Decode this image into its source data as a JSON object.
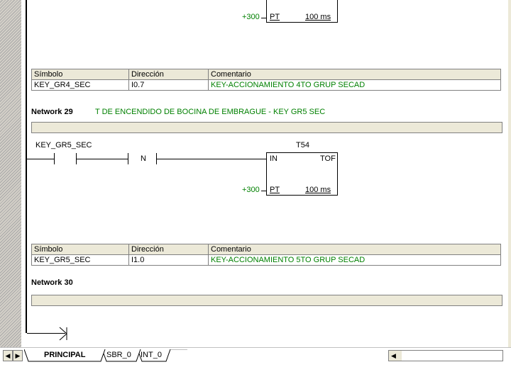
{
  "top_timer": {
    "pt_value": "+300",
    "pt_label": "PT",
    "time_base": "100 ms"
  },
  "symbol_table_1": {
    "headers": [
      "Símbolo",
      "Dirección",
      "Comentario"
    ],
    "row": [
      "KEY_GR4_SEC",
      "I0.7",
      "KEY-ACCIONAMIENTO 4TO GRUP SECAD"
    ]
  },
  "network_29": {
    "label": "Network 29",
    "title": "T DE ENCENDIDO DE BOCINA DE EMBRAGUE - KEY GR5 SEC",
    "contact_symbol": "KEY_GR5_SEC",
    "edge_label": "N",
    "timer_name": "T54",
    "timer_in": "IN",
    "timer_type": "TOF",
    "pt_value": "+300",
    "pt_label": "PT",
    "time_base": "100 ms"
  },
  "symbol_table_2": {
    "headers": [
      "Símbolo",
      "Dirección",
      "Comentario"
    ],
    "row": [
      "KEY_GR5_SEC",
      "I1.0",
      "KEY-ACCIONAMIENTO 5TO GRUP SECAD"
    ]
  },
  "network_30": {
    "label": "Network 30"
  },
  "tabs": [
    "PRINCIPAL",
    "SBR_0",
    "INT_0"
  ],
  "colors": {
    "comment_green": "#008000",
    "panel": "#ece9d8"
  }
}
